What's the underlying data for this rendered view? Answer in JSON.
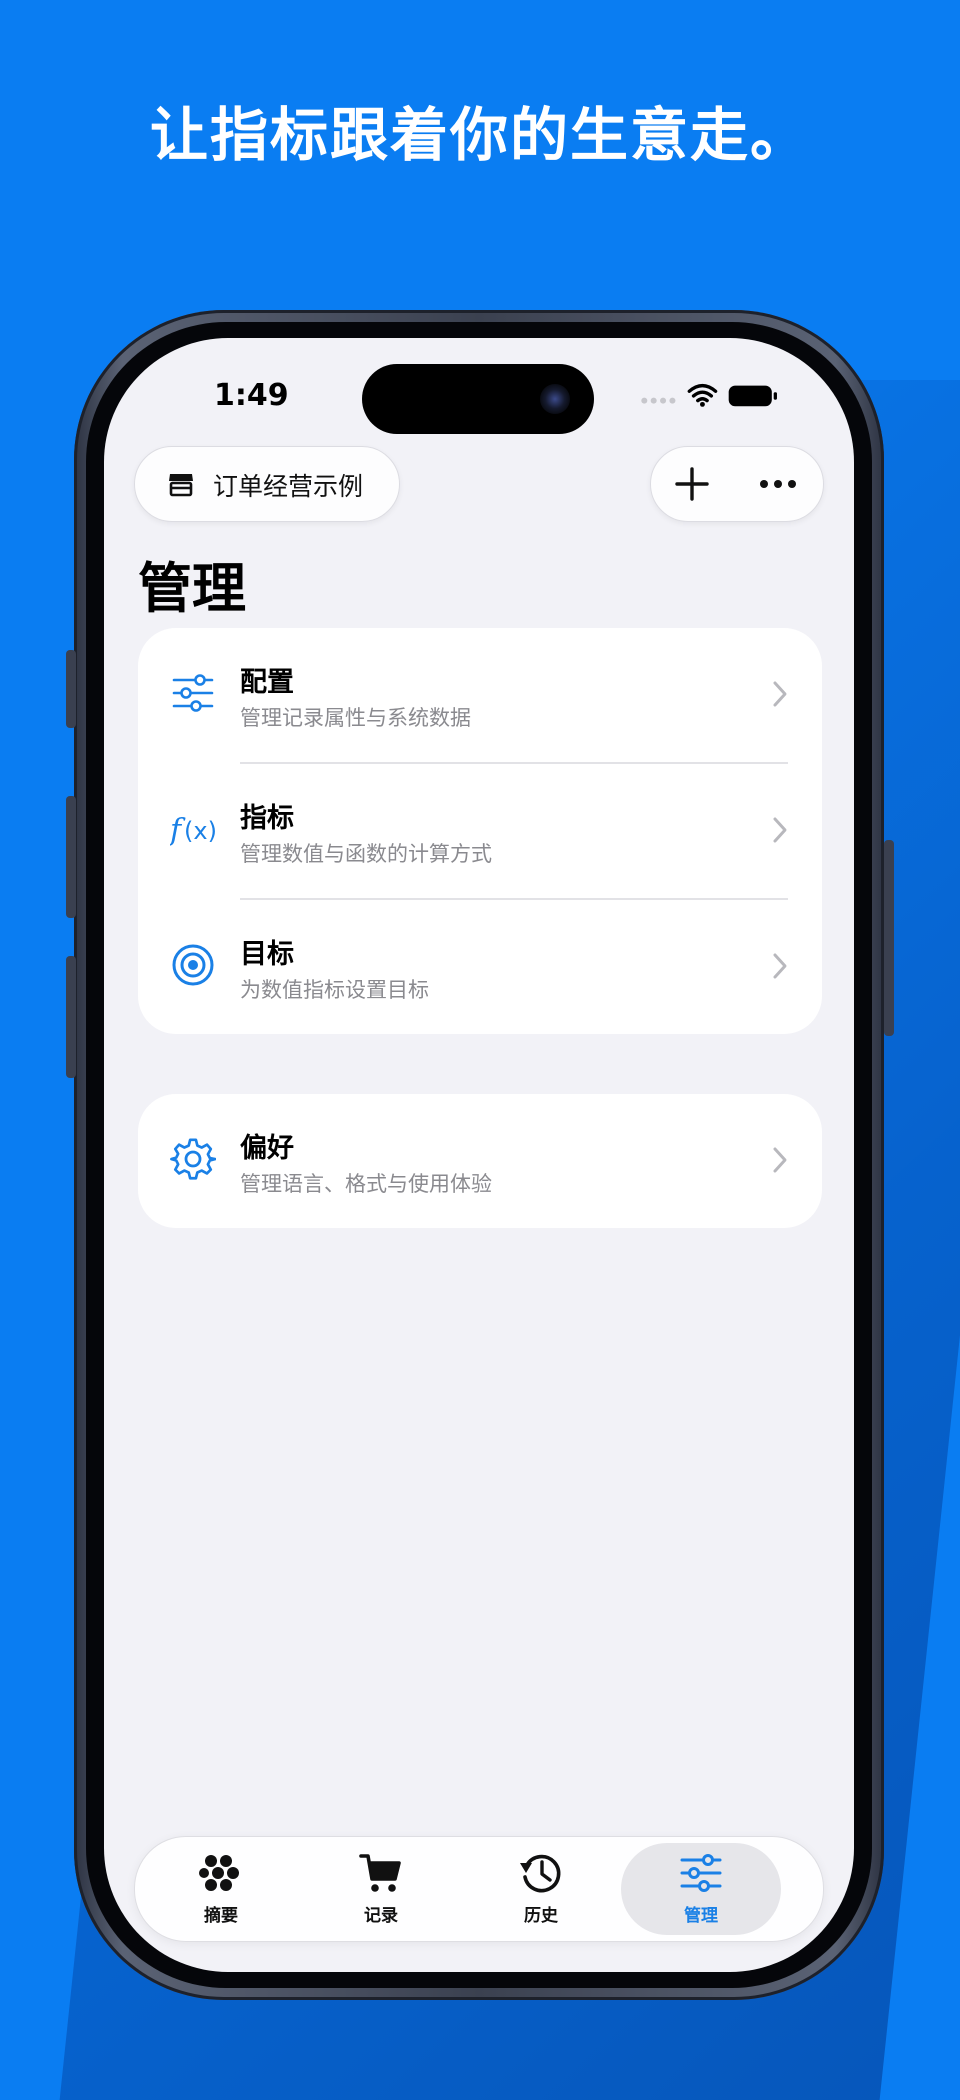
{
  "headline": "让指标跟着你的生意走。",
  "status_bar": {
    "time": "1:49"
  },
  "toolbar": {
    "store_name": "订单经营示例"
  },
  "page": {
    "title": "管理"
  },
  "sections": [
    {
      "items": [
        {
          "title": "配置",
          "subtitle": "管理记录属性与系统数据",
          "icon": "sliders-icon"
        },
        {
          "title": "指标",
          "subtitle": "管理数值与函数的计算方式",
          "icon": "function-icon"
        },
        {
          "title": "目标",
          "subtitle": "为数值指标设置目标",
          "icon": "target-icon"
        }
      ]
    },
    {
      "items": [
        {
          "title": "偏好",
          "subtitle": "管理语言、格式与使用体验",
          "icon": "gear-icon"
        }
      ]
    }
  ],
  "tabs": [
    {
      "label": "摘要",
      "icon": "dots-cluster-icon",
      "active": false
    },
    {
      "label": "记录",
      "icon": "cart-icon",
      "active": false
    },
    {
      "label": "历史",
      "icon": "history-icon",
      "active": false
    },
    {
      "label": "管理",
      "icon": "sliders-icon",
      "active": true
    }
  ],
  "colors": {
    "background": "#0a7df2",
    "accent": "#1a80e6",
    "screen": "#f2f2f7"
  }
}
